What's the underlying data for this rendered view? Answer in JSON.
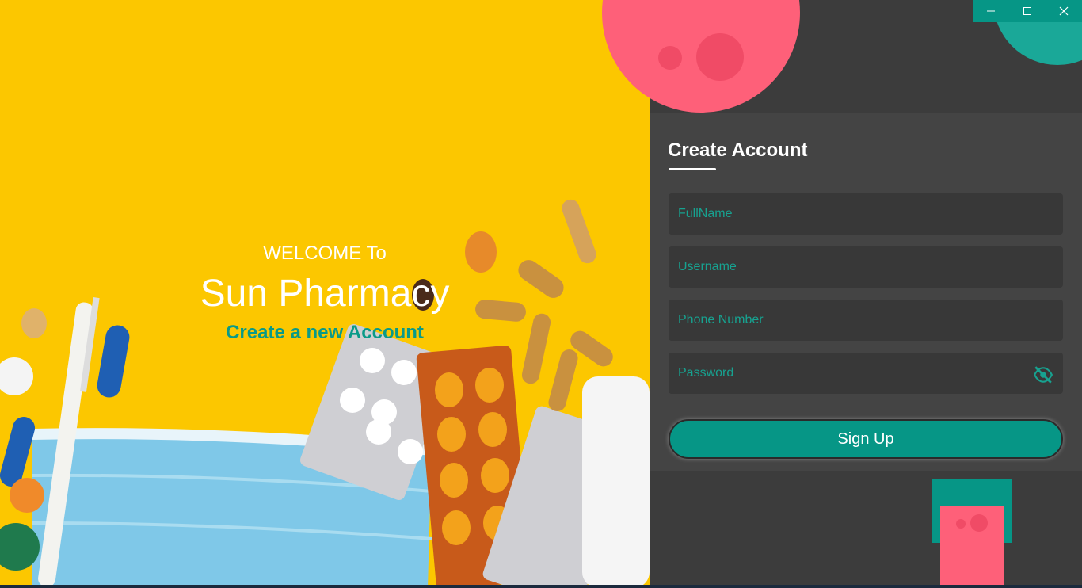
{
  "hero": {
    "welcome": "WELCOME To",
    "brand": "Sun Pharmacy",
    "subtitle": "Create a new Account"
  },
  "form": {
    "title": "Create Account",
    "fullname_placeholder": "FullName",
    "username_placeholder": "Username",
    "phone_placeholder": "Phone Number",
    "password_placeholder": "Password",
    "signup_label": "Sign Up",
    "password_toggle_icon": "eye-off-icon"
  },
  "window_controls": [
    "minimize-icon",
    "maximize-icon",
    "close-icon"
  ],
  "colors": {
    "accent": "#069686",
    "hero_bg": "#fcc700",
    "pink": "#fe6079",
    "panel": "#444444"
  }
}
